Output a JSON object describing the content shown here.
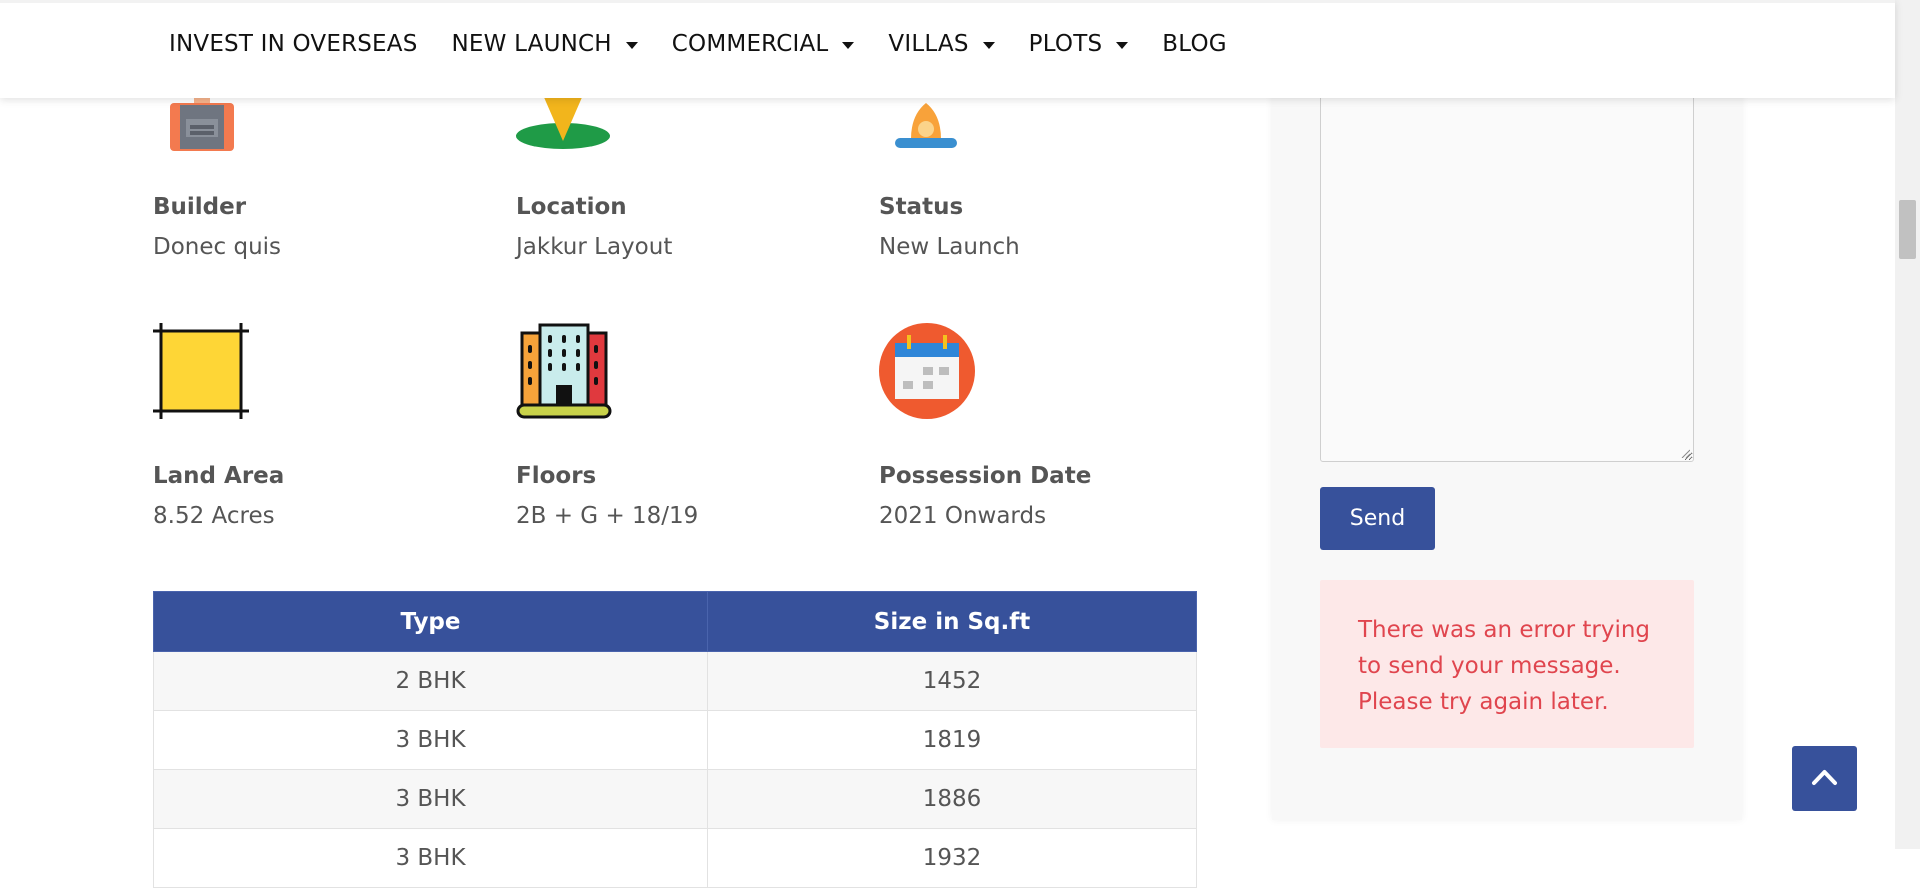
{
  "nav": {
    "items": [
      {
        "label": "INVEST IN OVERSEAS",
        "has_dropdown": false
      },
      {
        "label": "NEW LAUNCH",
        "has_dropdown": true
      },
      {
        "label": "COMMERCIAL",
        "has_dropdown": true
      },
      {
        "label": "VILLAS",
        "has_dropdown": true
      },
      {
        "label": "PLOTS",
        "has_dropdown": true
      },
      {
        "label": "BLOG",
        "has_dropdown": false
      }
    ]
  },
  "features": [
    {
      "label": "Builder",
      "value": "Donec quis",
      "icon": "builder-icon"
    },
    {
      "label": "Location",
      "value": "Jakkur Layout",
      "icon": "location-pin-icon"
    },
    {
      "label": "Status",
      "value": "New Launch",
      "icon": "status-bell-icon"
    },
    {
      "label": "Land Area",
      "value": "8.52 Acres",
      "icon": "land-area-icon"
    },
    {
      "label": "Floors",
      "value": "2B + G + 18/19",
      "icon": "building-icon"
    },
    {
      "label": "Possession Date",
      "value": "2021 Onwards",
      "icon": "calendar-icon"
    }
  ],
  "table": {
    "headers": [
      "Type",
      "Size in Sq.ft"
    ],
    "rows": [
      [
        "2 BHK",
        "1452"
      ],
      [
        "3 BHK",
        "1819"
      ],
      [
        "3 BHK",
        "1886"
      ],
      [
        "3 BHK",
        "1932"
      ]
    ]
  },
  "contact_form": {
    "send_label": "Send",
    "error_message": "There was an error trying to send your message. Please try again later."
  },
  "colors": {
    "primary": "#37519b",
    "error_text": "#e0454e",
    "error_bg": "#fde8e8"
  }
}
